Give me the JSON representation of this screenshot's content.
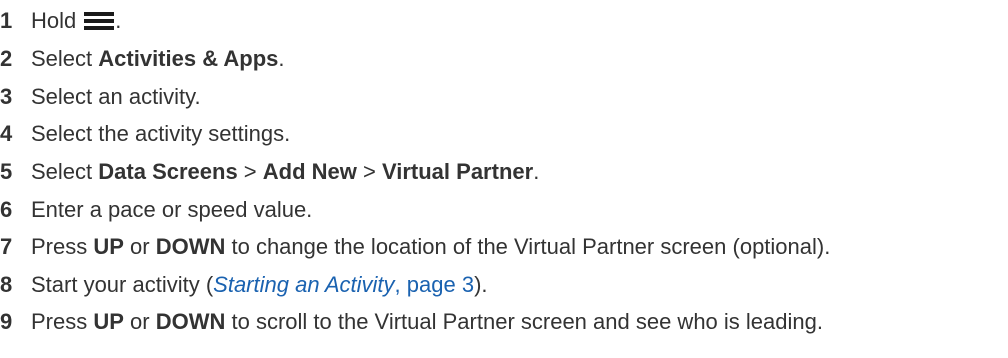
{
  "steps": [
    {
      "num": "1",
      "parts": {
        "a": "Hold",
        "icon": "menu-icon",
        "b": "."
      }
    },
    {
      "num": "2",
      "parts": {
        "a": "Select ",
        "b": "Activities & Apps",
        "c": "."
      }
    },
    {
      "num": "3",
      "parts": {
        "a": "Select an activity."
      }
    },
    {
      "num": "4",
      "parts": {
        "a": "Select the activity settings."
      }
    },
    {
      "num": "5",
      "parts": {
        "a": "Select ",
        "b": "Data Screens",
        "c": " > ",
        "d": "Add New",
        "e": " > ",
        "f": "Virtual Partner",
        "g": "."
      }
    },
    {
      "num": "6",
      "parts": {
        "a": "Enter a pace or speed value."
      }
    },
    {
      "num": "7",
      "parts": {
        "a": "Press ",
        "b": "UP",
        "c": " or ",
        "d": "DOWN",
        "e": " to change the location of the Virtual Partner screen (optional)."
      }
    },
    {
      "num": "8",
      "parts": {
        "a": "Start your activity (",
        "link_title": "Starting an Activity",
        "link_sep": ", ",
        "link_page": "page 3",
        "b": ")."
      }
    },
    {
      "num": "9",
      "parts": {
        "a": "Press ",
        "b": "UP",
        "c": " or ",
        "d": "DOWN",
        "e": " to scroll to the Virtual Partner screen and see who is leading."
      }
    }
  ]
}
